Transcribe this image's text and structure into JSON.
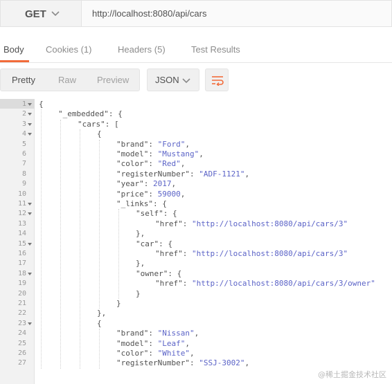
{
  "request": {
    "method": "GET",
    "url": "http://localhost:8080/api/cars"
  },
  "response_tabs": [
    {
      "label": "Body",
      "count": "",
      "active": true
    },
    {
      "label": "Cookies",
      "count": "(1)",
      "active": false
    },
    {
      "label": "Headers",
      "count": "(5)",
      "active": false
    },
    {
      "label": "Test Results",
      "count": "",
      "active": false
    }
  ],
  "view_modes": [
    "Pretty",
    "Raw",
    "Preview"
  ],
  "active_view": "Pretty",
  "format": "JSON",
  "colors": {
    "accent": "#f26b3a",
    "string": "#5b63c7"
  },
  "code_lines": [
    {
      "n": "1",
      "fold": true,
      "indent": 0,
      "tokens": [
        [
          "p",
          "{"
        ]
      ]
    },
    {
      "n": "2",
      "fold": true,
      "indent": 1,
      "tokens": [
        [
          "k",
          "\"_embedded\""
        ],
        [
          "p",
          ": {"
        ]
      ]
    },
    {
      "n": "3",
      "fold": true,
      "indent": 2,
      "tokens": [
        [
          "k",
          "\"cars\""
        ],
        [
          "p",
          ": ["
        ]
      ]
    },
    {
      "n": "4",
      "fold": true,
      "indent": 3,
      "tokens": [
        [
          "p",
          "{"
        ]
      ]
    },
    {
      "n": "5",
      "fold": false,
      "indent": 4,
      "tokens": [
        [
          "k",
          "\"brand\""
        ],
        [
          "p",
          ": "
        ],
        [
          "s",
          "\"Ford\""
        ],
        [
          "p",
          ","
        ]
      ]
    },
    {
      "n": "6",
      "fold": false,
      "indent": 4,
      "tokens": [
        [
          "k",
          "\"model\""
        ],
        [
          "p",
          ": "
        ],
        [
          "s",
          "\"Mustang\""
        ],
        [
          "p",
          ","
        ]
      ]
    },
    {
      "n": "7",
      "fold": false,
      "indent": 4,
      "tokens": [
        [
          "k",
          "\"color\""
        ],
        [
          "p",
          ": "
        ],
        [
          "s",
          "\"Red\""
        ],
        [
          "p",
          ","
        ]
      ]
    },
    {
      "n": "8",
      "fold": false,
      "indent": 4,
      "tokens": [
        [
          "k",
          "\"registerNumber\""
        ],
        [
          "p",
          ": "
        ],
        [
          "s",
          "\"ADF-1121\""
        ],
        [
          "p",
          ","
        ]
      ]
    },
    {
      "n": "9",
      "fold": false,
      "indent": 4,
      "tokens": [
        [
          "k",
          "\"year\""
        ],
        [
          "p",
          ": "
        ],
        [
          "n",
          "2017"
        ],
        [
          "p",
          ","
        ]
      ]
    },
    {
      "n": "10",
      "fold": false,
      "indent": 4,
      "tokens": [
        [
          "k",
          "\"price\""
        ],
        [
          "p",
          ": "
        ],
        [
          "n",
          "59000"
        ],
        [
          "p",
          ","
        ]
      ]
    },
    {
      "n": "11",
      "fold": true,
      "indent": 4,
      "tokens": [
        [
          "k",
          "\"_links\""
        ],
        [
          "p",
          ": {"
        ]
      ]
    },
    {
      "n": "12",
      "fold": true,
      "indent": 5,
      "tokens": [
        [
          "k",
          "\"self\""
        ],
        [
          "p",
          ": {"
        ]
      ]
    },
    {
      "n": "13",
      "fold": false,
      "indent": 6,
      "tokens": [
        [
          "k",
          "\"href\""
        ],
        [
          "p",
          ": "
        ],
        [
          "s",
          "\"http://localhost:8080/api/cars/3\""
        ]
      ]
    },
    {
      "n": "14",
      "fold": false,
      "indent": 5,
      "tokens": [
        [
          "p",
          "},"
        ]
      ]
    },
    {
      "n": "15",
      "fold": true,
      "indent": 5,
      "tokens": [
        [
          "k",
          "\"car\""
        ],
        [
          "p",
          ": {"
        ]
      ]
    },
    {
      "n": "16",
      "fold": false,
      "indent": 6,
      "tokens": [
        [
          "k",
          "\"href\""
        ],
        [
          "p",
          ": "
        ],
        [
          "s",
          "\"http://localhost:8080/api/cars/3\""
        ]
      ]
    },
    {
      "n": "17",
      "fold": false,
      "indent": 5,
      "tokens": [
        [
          "p",
          "},"
        ]
      ]
    },
    {
      "n": "18",
      "fold": true,
      "indent": 5,
      "tokens": [
        [
          "k",
          "\"owner\""
        ],
        [
          "p",
          ": {"
        ]
      ]
    },
    {
      "n": "19",
      "fold": false,
      "indent": 6,
      "tokens": [
        [
          "k",
          "\"href\""
        ],
        [
          "p",
          ": "
        ],
        [
          "s",
          "\"http://localhost:8080/api/cars/3/owner\""
        ]
      ]
    },
    {
      "n": "20",
      "fold": false,
      "indent": 5,
      "tokens": [
        [
          "p",
          "}"
        ]
      ]
    },
    {
      "n": "21",
      "fold": false,
      "indent": 4,
      "tokens": [
        [
          "p",
          "}"
        ]
      ]
    },
    {
      "n": "22",
      "fold": false,
      "indent": 3,
      "tokens": [
        [
          "p",
          "},"
        ]
      ]
    },
    {
      "n": "23",
      "fold": true,
      "indent": 3,
      "tokens": [
        [
          "p",
          "{"
        ]
      ]
    },
    {
      "n": "24",
      "fold": false,
      "indent": 4,
      "tokens": [
        [
          "k",
          "\"brand\""
        ],
        [
          "p",
          ": "
        ],
        [
          "s",
          "\"Nissan\""
        ],
        [
          "p",
          ","
        ]
      ]
    },
    {
      "n": "25",
      "fold": false,
      "indent": 4,
      "tokens": [
        [
          "k",
          "\"model\""
        ],
        [
          "p",
          ": "
        ],
        [
          "s",
          "\"Leaf\""
        ],
        [
          "p",
          ","
        ]
      ]
    },
    {
      "n": "26",
      "fold": false,
      "indent": 4,
      "tokens": [
        [
          "k",
          "\"color\""
        ],
        [
          "p",
          ": "
        ],
        [
          "s",
          "\"White\""
        ],
        [
          "p",
          ","
        ]
      ]
    },
    {
      "n": "27",
      "fold": false,
      "indent": 4,
      "tokens": [
        [
          "k",
          "\"registerNumber\""
        ],
        [
          "p",
          ": "
        ],
        [
          "s",
          "\"SSJ-3002\""
        ],
        [
          "p",
          ","
        ]
      ]
    }
  ],
  "watermark": "@稀土掘金技术社区"
}
